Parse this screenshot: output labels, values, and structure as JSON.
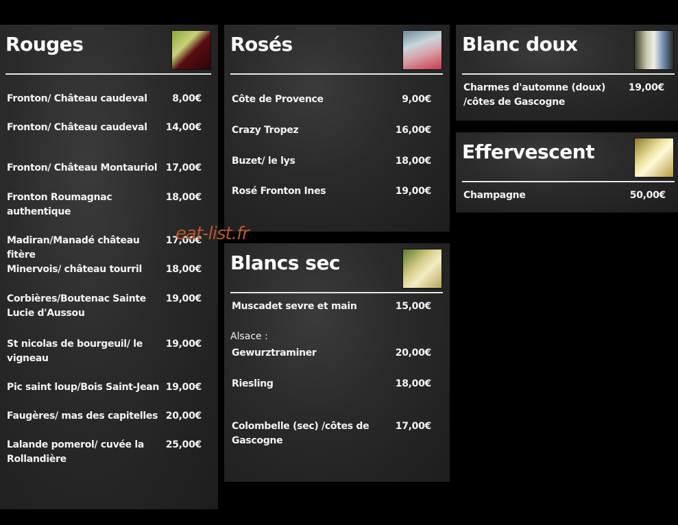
{
  "watermark": "eat-list.fr",
  "rouges": {
    "title": "Rouges",
    "items": [
      {
        "name": "Fronton/ Château caudeval",
        "price": "8,00€"
      },
      {
        "name": "Fronton/ Château caudeval",
        "price": "14,00€"
      },
      {
        "name": "Fronton/ Château Montauriol",
        "price": "17,00€"
      },
      {
        "name": "Fronton Roumagnac\nauthentique",
        "price": "18,00€"
      },
      {
        "name": "Madiran/Manadé château fitère",
        "price": "17,00€"
      },
      {
        "name": "Minervois/ château tourril",
        "price": "18,00€"
      },
      {
        "name": "Corbières/Boutenac Sainte\nLucie d'Aussou",
        "price": "19,00€"
      },
      {
        "name": "St nicolas de bourgeuil/ le\nvigneau",
        "price": "19,00€"
      },
      {
        "name": "Pic saint loup/Bois Saint-Jean",
        "price": "19,00€"
      },
      {
        "name": "Faugères/ mas des capitelles",
        "price": "20,00€"
      },
      {
        "name": "Lalande pomerol/ cuvée la\nRollandière",
        "price": "25,00€"
      }
    ]
  },
  "roses": {
    "title": "Rosés",
    "items": [
      {
        "name": "Côte de Provence",
        "price": "9,00€"
      },
      {
        "name": "Crazy Tropez",
        "price": "16,00€"
      },
      {
        "name": "Buzet/ le lys",
        "price": "18,00€"
      },
      {
        "name": "Rosé Fronton Ines",
        "price": "19,00€"
      }
    ]
  },
  "blancs_sec": {
    "title": "Blancs sec",
    "subheading": "Alsace :",
    "items": [
      {
        "name": "Muscadet sevre et main",
        "price": "15,00€"
      },
      {
        "name": "Gewurztraminer",
        "price": "20,00€"
      },
      {
        "name": "Riesling",
        "price": "18,00€"
      },
      {
        "name": "Colombelle (sec) /côtes de\nGascogne",
        "price": "17,00€"
      }
    ]
  },
  "blanc_doux": {
    "title": "Blanc doux",
    "items": [
      {
        "name": "Charmes d'automne (doux)\n/côtes de Gascogne",
        "price": "19,00€"
      }
    ]
  },
  "effervescent": {
    "title": "Effervescent",
    "items": [
      {
        "name": "Champagne",
        "price": "50,00€"
      }
    ]
  },
  "icons": [
    "red-wine-glass-photo",
    "rose-wine-pour-photo",
    "white-wine-glass-photo",
    "white-wine-bottle-photo",
    "champagne-glass-photo"
  ]
}
